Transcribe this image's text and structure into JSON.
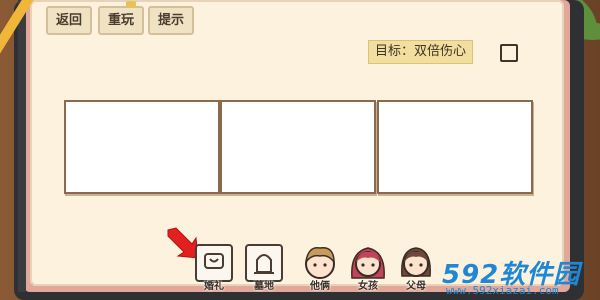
{
  "toolbar": {
    "back_label": "返回",
    "replay_label": "重玩",
    "hint_label": "提示"
  },
  "goal": {
    "text": "目标：双倍伤心"
  },
  "slots": [
    {
      "label": ""
    },
    {
      "label": ""
    },
    {
      "label": ""
    }
  ],
  "items": [
    {
      "label": "婚礼",
      "icon": "ring-card-icon"
    },
    {
      "label": "墓地",
      "icon": "tombstone-card-icon"
    },
    {
      "label": "他俩",
      "icon": "boy-portrait-icon"
    },
    {
      "label": "女孩",
      "icon": "girl-portrait-icon"
    },
    {
      "label": "父母",
      "icon": "woman-portrait-icon"
    }
  ],
  "watermark": {
    "brand": "592软件园",
    "url": "www.592xiazai.com"
  },
  "colors": {
    "paper": "#fdf2de",
    "accent_red": "#e32020",
    "watermark_blue": "#1e87d6"
  }
}
